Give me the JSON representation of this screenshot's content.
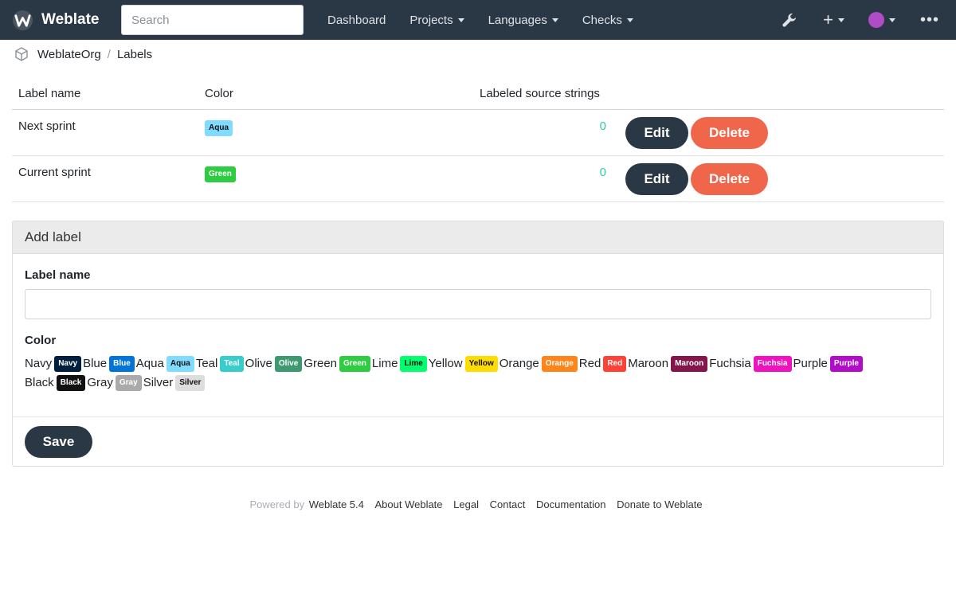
{
  "navbar": {
    "brand": "Weblate",
    "search_placeholder": "Search",
    "links": [
      "Dashboard",
      "Projects",
      "Languages",
      "Checks"
    ],
    "icons": [
      "wrench-icon",
      "plus-icon",
      "avatar-icon",
      "more-icon"
    ]
  },
  "breadcrumb": {
    "items": [
      "WeblateOrg",
      "Labels"
    ],
    "separator": "/"
  },
  "table": {
    "headers": [
      "Label name",
      "Color",
      "Labeled source strings"
    ],
    "rows": [
      {
        "name": "Next sprint",
        "color_label": "Aqua",
        "color_hex": "#7fdbff",
        "count": "0",
        "edit": "Edit",
        "delete": "Delete"
      },
      {
        "name": "Current sprint",
        "color_label": "Green",
        "color_hex": "#2ecc40",
        "count": "0",
        "edit": "Edit",
        "delete": "Delete"
      }
    ]
  },
  "form": {
    "title": "Add label",
    "name_label": "Label name",
    "name_value": "",
    "color_label": "Color",
    "colors": [
      {
        "name": "Navy",
        "hex": "#001f3f"
      },
      {
        "name": "Blue",
        "hex": "#0074d9"
      },
      {
        "name": "Aqua",
        "hex": "#7fdbff"
      },
      {
        "name": "Teal",
        "hex": "#39cccc"
      },
      {
        "name": "Olive",
        "hex": "#3d9970"
      },
      {
        "name": "Green",
        "hex": "#2ecc40"
      },
      {
        "name": "Lime",
        "hex": "#01ff70"
      },
      {
        "name": "Yellow",
        "hex": "#ffdc00"
      },
      {
        "name": "Orange",
        "hex": "#ff851b"
      },
      {
        "name": "Red",
        "hex": "#ff4136"
      },
      {
        "name": "Maroon",
        "hex": "#85144b"
      },
      {
        "name": "Fuchsia",
        "hex": "#f012be"
      },
      {
        "name": "Purple",
        "hex": "#b10dc9"
      },
      {
        "name": "Black",
        "hex": "#111111"
      },
      {
        "name": "Gray",
        "hex": "#aaaaaa"
      },
      {
        "name": "Silver",
        "hex": "#dddddd"
      }
    ],
    "save": "Save"
  },
  "footer": {
    "powered_by": "Powered by",
    "links": [
      "Weblate 5.4",
      "About Weblate",
      "Legal",
      "Contact",
      "Documentation",
      "Donate to Weblate"
    ]
  }
}
